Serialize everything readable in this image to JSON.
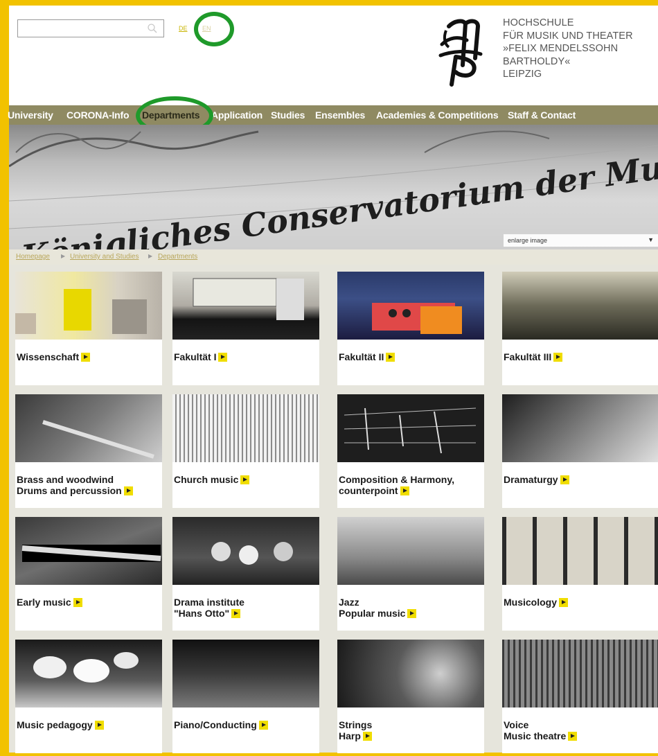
{
  "search": {
    "placeholder": ""
  },
  "languages": {
    "de": "DE",
    "en": "EN"
  },
  "school": {
    "lines": [
      "HOCHSCHULE",
      "FÜR MUSIK UND THEATER",
      "»FELIX MENDELSSOHN",
      "BARTHOLDY«",
      "LEIPZIG"
    ]
  },
  "nav": {
    "items": [
      "University",
      "CORONA-Info",
      "Departments",
      "Application",
      "Studies",
      "Ensembles",
      "Academies & Competitions",
      "Staff & Contact"
    ],
    "active": "Departments"
  },
  "banner": {
    "text": "Königliches Conservatorium der Musik zu Leipzig.",
    "enlarge_label": "enlarge image"
  },
  "breadcrumb": [
    "Homepage",
    "University and Studies",
    "Departments"
  ],
  "departments": [
    {
      "lines": [
        "Wissenschaft"
      ]
    },
    {
      "lines": [
        "Fakultät I"
      ]
    },
    {
      "lines": [
        "Fakultät II"
      ]
    },
    {
      "lines": [
        "Fakultät III"
      ]
    },
    {
      "lines": [
        "Brass and woodwind",
        "Drums and percussion"
      ]
    },
    {
      "lines": [
        "Church music"
      ]
    },
    {
      "lines": [
        "Composition & Harmony,",
        "counterpoint"
      ]
    },
    {
      "lines": [
        "Dramaturgy"
      ]
    },
    {
      "lines": [
        "Early music"
      ]
    },
    {
      "lines": [
        "Drama institute",
        "\"Hans Otto\""
      ]
    },
    {
      "lines": [
        "Jazz",
        "Popular music"
      ]
    },
    {
      "lines": [
        "Musicology"
      ]
    },
    {
      "lines": [
        "Music pedagogy"
      ]
    },
    {
      "lines": [
        "Piano/Conducting"
      ]
    },
    {
      "lines": [
        "Strings",
        "Harp"
      ]
    },
    {
      "lines": [
        "Voice",
        "Music theatre"
      ]
    }
  ],
  "colors": {
    "frame": "#f2c200",
    "nav_bg": "#8f8a62",
    "annotation": "#1f9a2a",
    "arrow_box": "#f0dd00"
  }
}
